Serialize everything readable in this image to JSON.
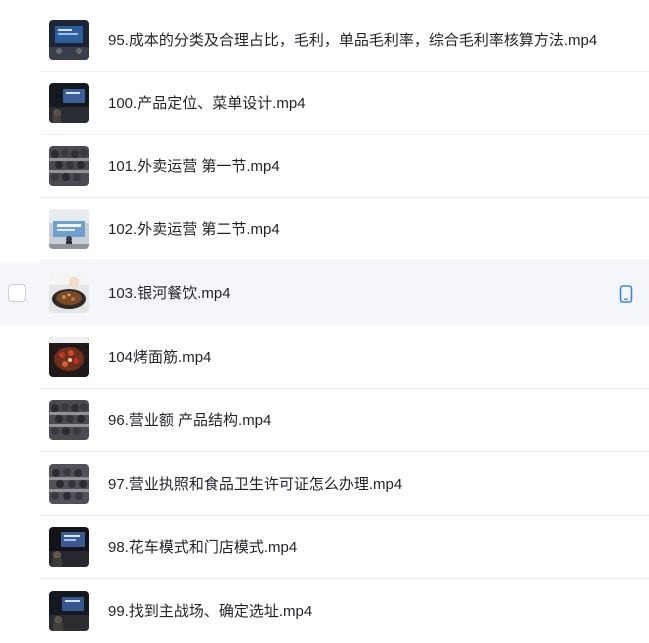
{
  "files": [
    {
      "name": "95.成本的分类及合理占比，毛利，单品毛利率，综合毛利率核算方法.mp4",
      "thumb": "presentation-dark"
    },
    {
      "name": "100.产品定位、菜单设计.mp4",
      "thumb": "presentation-dark"
    },
    {
      "name": "101.外卖运营 第一节.mp4",
      "thumb": "audience"
    },
    {
      "name": "102.外卖运营 第二节.mp4",
      "thumb": "stage-bright"
    },
    {
      "name": "103.银河餐饮.mp4",
      "thumb": "cooking-wok"
    },
    {
      "name": "104烤面筋.mp4",
      "thumb": "chili-food"
    },
    {
      "name": "96.营业额 产品结构.mp4",
      "thumb": "audience"
    },
    {
      "name": "97.营业执照和食品卫生许可证怎么办理.mp4",
      "thumb": "audience"
    },
    {
      "name": "98.花车模式和门店模式.mp4",
      "thumb": "presentation-dark"
    },
    {
      "name": "99.找到主战场、确定选址.mp4",
      "thumb": "presentation-dark"
    }
  ],
  "hovered_index": 4,
  "hover_action_icon": "mobile-phone-icon",
  "colors": {
    "text": "#1f2329",
    "hover_bg": "#f5f6fa",
    "divider": "#eef0f4",
    "accent": "#3b82f6"
  }
}
